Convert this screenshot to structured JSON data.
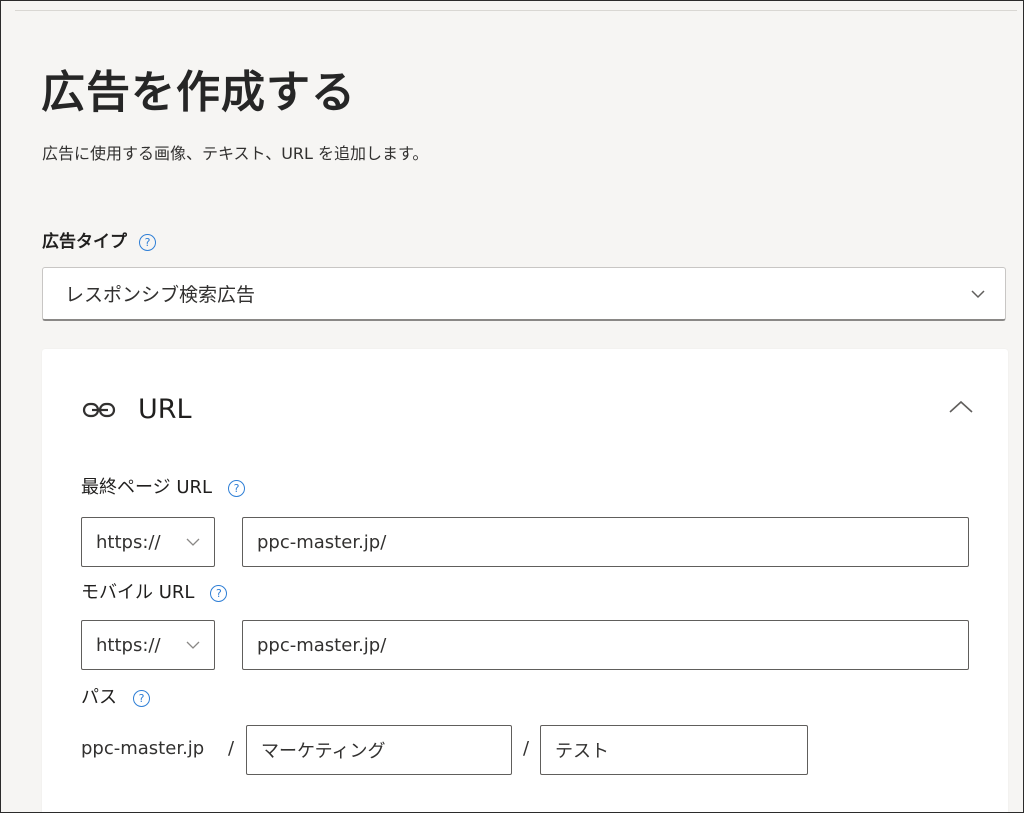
{
  "header": {
    "title": "広告を作成する",
    "subtitle": "広告に使用する画像、テキスト、URL を追加します。"
  },
  "ad_type": {
    "label": "広告タイプ",
    "help_icon": "question-circle-icon",
    "selected": "レスポンシブ検索広告"
  },
  "url_section": {
    "title": "URL",
    "icon": "link-icon",
    "final_url": {
      "label": "最終ページ URL",
      "protocol": "https://",
      "value": "ppc-master.jp/"
    },
    "mobile_url": {
      "label": "モバイル URL",
      "protocol": "https://",
      "value": "ppc-master.jp/"
    },
    "path": {
      "label": "パス",
      "domain": "ppc-master.jp",
      "separator": "/",
      "path1": "マーケティング",
      "path2": "テスト"
    }
  },
  "colors": {
    "accent": "#2f7fd6",
    "background": "#f6f5f3",
    "card": "#ffffff",
    "border": "#605e5c"
  }
}
